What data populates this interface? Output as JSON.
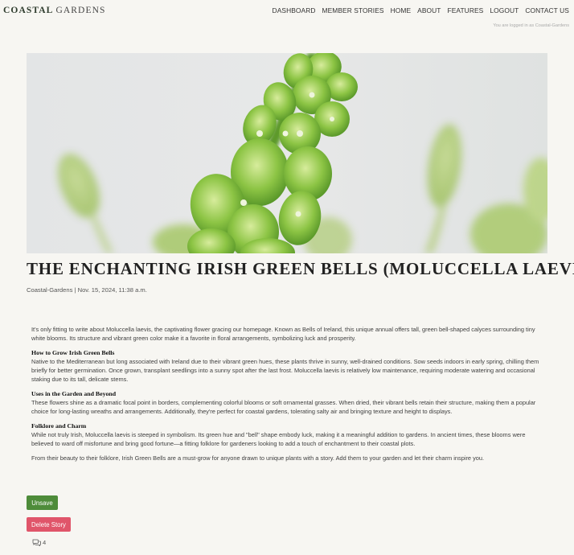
{
  "brand": {
    "part1": "COASTAL",
    "part2": "GARDENS"
  },
  "nav": {
    "items": [
      {
        "label": "DASHBOARD"
      },
      {
        "label": "MEMBER STORIES"
      },
      {
        "label": "HOME"
      },
      {
        "label": "ABOUT"
      },
      {
        "label": "FEATURES"
      },
      {
        "label": "LOGOUT"
      },
      {
        "label": "CONTACT US"
      }
    ]
  },
  "session": {
    "logged_in_text": "You are logged in as Coastal-Gardens"
  },
  "article": {
    "title": "THE ENCHANTING IRISH GREEN BELLS (MOLUCCELLA LAEVIS)",
    "meta": "Coastal-Gardens | Nov. 15, 2024, 11:38 a.m.",
    "intro": "It's only fitting to write about Moluccella laevis, the captivating flower gracing our homepage. Known as Bells of Ireland, this unique annual offers tall, green bell-shaped calyces surrounding tiny white blooms. Its structure and vibrant green color make it a favorite in floral arrangements, symbolizing luck and prosperity.",
    "sections": [
      {
        "heading": "How to Grow Irish Green Bells",
        "body": "Native to the Mediterranean but long associated with Ireland due to their vibrant green hues, these plants thrive in sunny, well-drained conditions. Sow seeds indoors in early spring, chilling them briefly for better germination. Once grown, transplant seedlings into a sunny spot after the last frost. Moluccella laevis is relatively low maintenance, requiring moderate watering and occasional staking due to its tall, delicate stems."
      },
      {
        "heading": "Uses in the Garden and Beyond",
        "body": "These flowers shine as a dramatic focal point in borders, complementing colorful blooms or soft ornamental grasses. When dried, their vibrant bells retain their structure, making them a popular choice for long-lasting wreaths and arrangements. Additionally, they're perfect for coastal gardens, tolerating salty air and bringing texture and height to displays."
      },
      {
        "heading": "Folklore and Charm",
        "body": "While not truly Irish, Moluccella laevis is steeped in symbolism. Its green hue and \"bell\" shape embody luck, making it a meaningful addition to gardens. In ancient times, these blooms were believed to ward off misfortune and bring good fortune—a fitting folklore for gardeners looking to add a touch of enchantment to their coastal plots."
      }
    ],
    "closing": "From their beauty to their folklore, Irish Green Bells are a must-grow for anyone drawn to unique plants with a story. Add them to your garden and let their charm inspire you."
  },
  "actions": {
    "unsave_label": "Unsave",
    "delete_label": "Delete Story"
  },
  "comments": {
    "icon": "comments-icon",
    "count": "4"
  },
  "colors": {
    "background": "#f7f6f2",
    "unsave": "#4e8c3a",
    "delete": "#e0556a",
    "plant_green": "#7fb83a"
  }
}
